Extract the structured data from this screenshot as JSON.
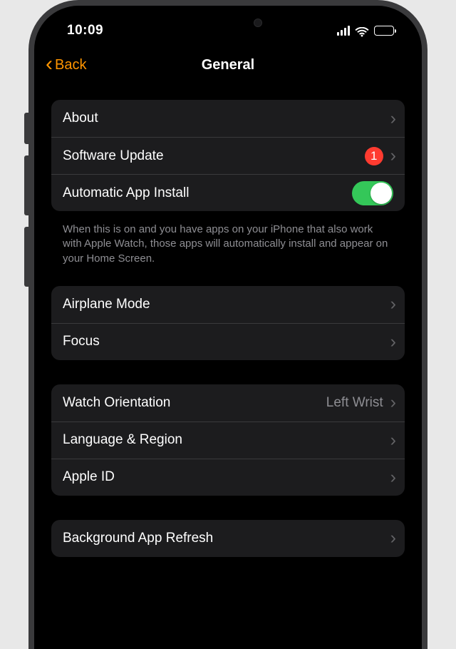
{
  "status": {
    "time": "10:09"
  },
  "nav": {
    "back": "Back",
    "title": "General"
  },
  "group1": {
    "about": "About",
    "softwareUpdate": "Software Update",
    "updateBadge": "1",
    "autoInstall": "Automatic App Install",
    "autoInstallOn": true,
    "footer": "When this is on and you have apps on your iPhone that also work with Apple Watch, those apps will automatically install and appear on your Home Screen."
  },
  "group2": {
    "airplaneMode": "Airplane Mode",
    "focus": "Focus"
  },
  "group3": {
    "watchOrientation": "Watch Orientation",
    "wristValue": "Left Wrist",
    "languageRegion": "Language & Region",
    "appleId": "Apple ID"
  },
  "group4": {
    "bgRefresh": "Background App Refresh"
  }
}
